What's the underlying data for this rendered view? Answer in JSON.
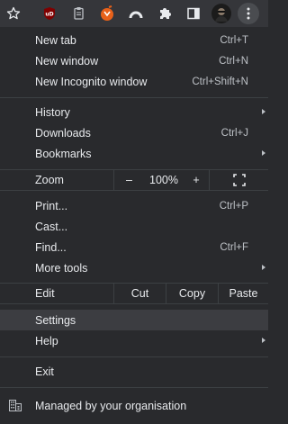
{
  "toolbar": {
    "icons": [
      "star-icon",
      "ublock-icon",
      "clipboard-icon",
      "extension-orange-icon",
      "arc-icon",
      "puzzle-icon",
      "sidepanel-icon",
      "avatar",
      "more-vert-icon"
    ],
    "ublock_text": "uD"
  },
  "menu": {
    "group1": [
      {
        "label": "New tab",
        "shortcut": "Ctrl+T"
      },
      {
        "label": "New window",
        "shortcut": "Ctrl+N"
      },
      {
        "label": "New Incognito window",
        "shortcut": "Ctrl+Shift+N"
      }
    ],
    "group2": [
      {
        "label": "History",
        "shortcut": ""
      },
      {
        "label": "Downloads",
        "shortcut": "Ctrl+J"
      },
      {
        "label": "Bookmarks",
        "shortcut": ""
      }
    ],
    "zoom": {
      "label": "Zoom",
      "minus": "–",
      "value": "100%",
      "plus": "+"
    },
    "group3": [
      {
        "label": "Print...",
        "shortcut": "Ctrl+P"
      },
      {
        "label": "Cast...",
        "shortcut": ""
      },
      {
        "label": "Find...",
        "shortcut": "Ctrl+F"
      },
      {
        "label": "More tools",
        "shortcut": ""
      }
    ],
    "edit": {
      "label": "Edit",
      "cut": "Cut",
      "copy": "Copy",
      "paste": "Paste"
    },
    "group4": [
      {
        "label": "Settings",
        "shortcut": ""
      },
      {
        "label": "Help",
        "shortcut": ""
      }
    ],
    "exit": {
      "label": "Exit"
    },
    "managed": {
      "label": "Managed by your organisation"
    }
  },
  "colors": {
    "background": "#292a2d",
    "toolbar": "#35363a",
    "highlight": "#3c3d41",
    "text": "#e8eaed",
    "ublock": "#800000",
    "orange_ext": "#e8611a"
  }
}
